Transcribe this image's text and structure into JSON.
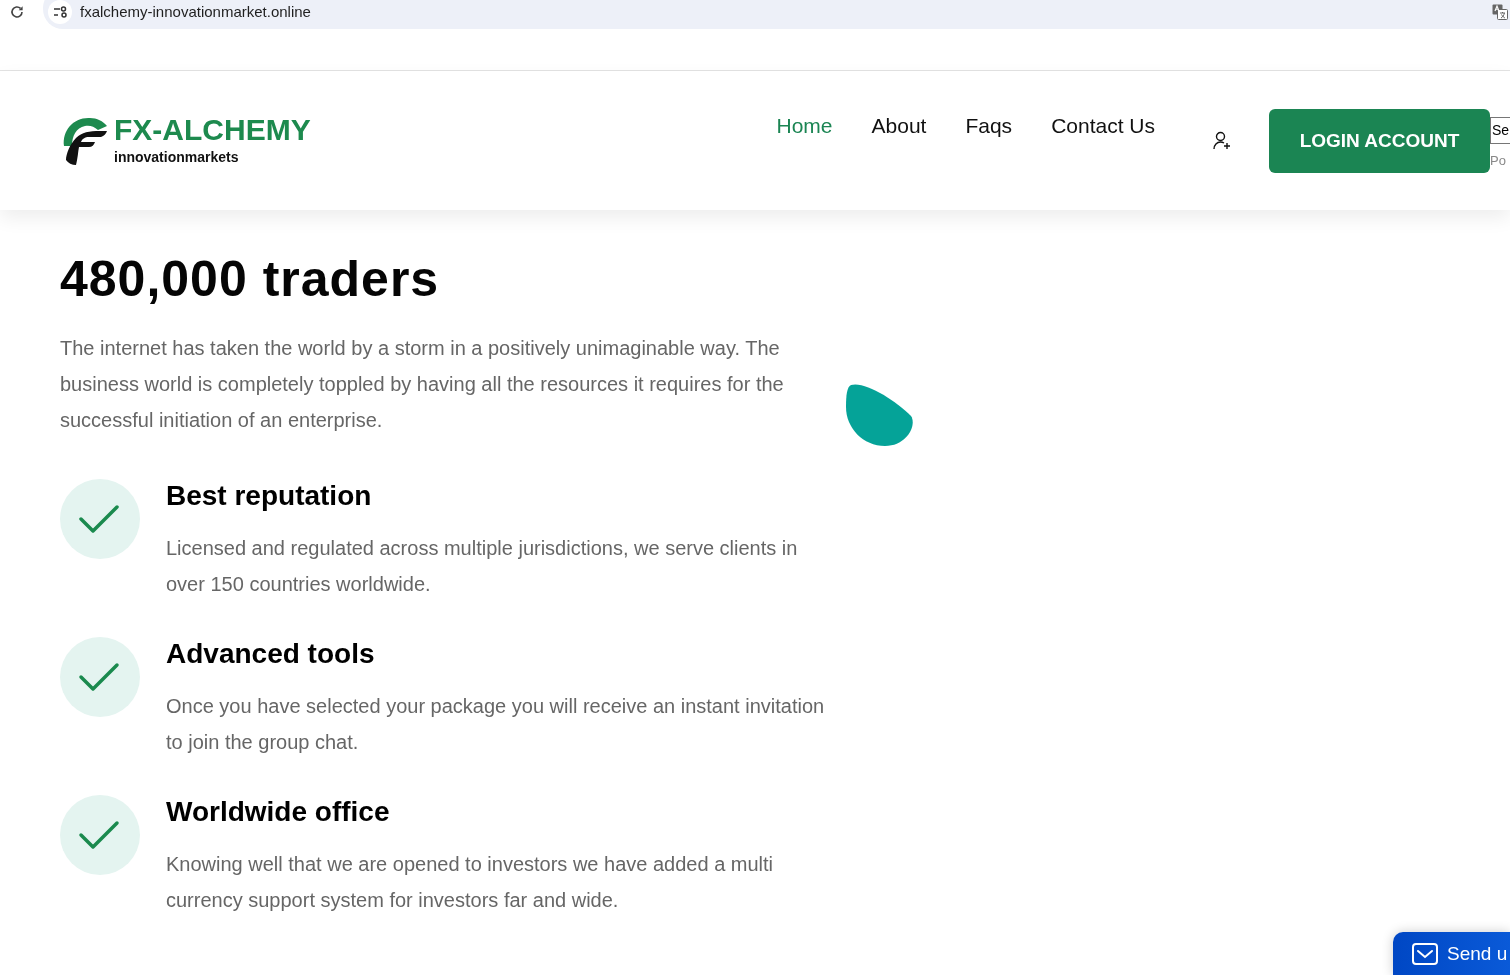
{
  "browser": {
    "url": "fxalchemy-innovationmarket.online"
  },
  "header": {
    "brand": {
      "name": "FX-ALCHEMY",
      "tagline": "innovationmarkets"
    },
    "nav": [
      {
        "label": "Home",
        "selected": true
      },
      {
        "label": "About",
        "selected": false
      },
      {
        "label": "Faqs",
        "selected": false
      },
      {
        "label": "Contact Us",
        "selected": false
      }
    ],
    "login_button": "LOGIN ACCOUNT",
    "translate": {
      "select_value": "Se",
      "powered_by": "Po"
    }
  },
  "hero": {
    "headline": "480,000 traders",
    "intro": "The internet has taken the world by a storm in a positively unimaginable way. The business world is completely toppled by having all the resources it requires for the successful initiation of an enterprise.",
    "features": [
      {
        "title": "Best reputation",
        "text": "Licensed and regulated across multiple jurisdictions, we serve clients in over 150 countries worldwide."
      },
      {
        "title": "Advanced tools",
        "text": "Once you have selected your package you will receive an instant invitation to join the group chat."
      },
      {
        "title": "Worldwide office",
        "text": "Knowing well that we are opened to investors we have added a multi currency support system for investors far and wide."
      }
    ]
  },
  "contact_widget": {
    "label": "Send u"
  }
}
